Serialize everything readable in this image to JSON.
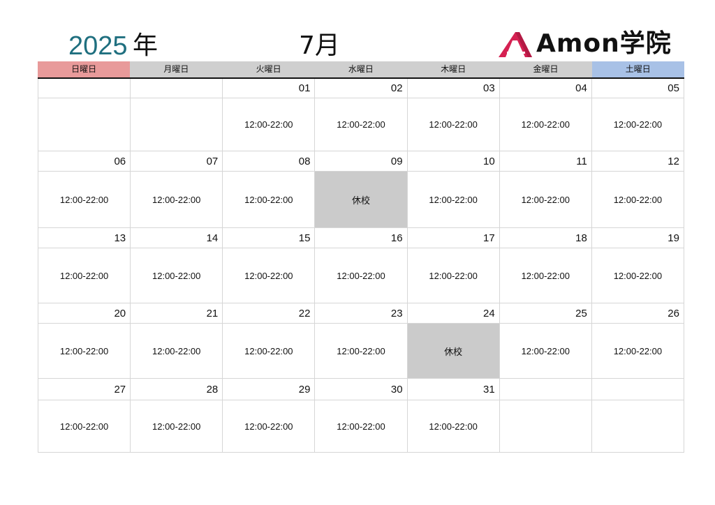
{
  "header": {
    "year": "2025",
    "year_suffix": "年",
    "month": "7月",
    "logo_text": "Amon学院",
    "logo_color": "#d52152"
  },
  "weekdays": [
    "日曜日",
    "月曜日",
    "火曜日",
    "水曜日",
    "木曜日",
    "金曜日",
    "土曜日"
  ],
  "colors": {
    "sunday": "#e89a9a",
    "saturday": "#a8c1e6",
    "weekday": "#cfcfcf",
    "closed": "#cbcbcb",
    "year": "#1f6f7f"
  },
  "weeks": [
    {
      "days": [
        {
          "date": "",
          "event": ""
        },
        {
          "date": "",
          "event": ""
        },
        {
          "date": "01",
          "event": "12:00-22:00"
        },
        {
          "date": "02",
          "event": "12:00-22:00"
        },
        {
          "date": "03",
          "event": "12:00-22:00"
        },
        {
          "date": "04",
          "event": "12:00-22:00"
        },
        {
          "date": "05",
          "event": "12:00-22:00"
        }
      ]
    },
    {
      "days": [
        {
          "date": "06",
          "event": "12:00-22:00"
        },
        {
          "date": "07",
          "event": "12:00-22:00"
        },
        {
          "date": "08",
          "event": "12:00-22:00"
        },
        {
          "date": "09",
          "event": "休校",
          "closed": true
        },
        {
          "date": "10",
          "event": "12:00-22:00"
        },
        {
          "date": "11",
          "event": "12:00-22:00"
        },
        {
          "date": "12",
          "event": "12:00-22:00"
        }
      ]
    },
    {
      "days": [
        {
          "date": "13",
          "event": "12:00-22:00"
        },
        {
          "date": "14",
          "event": "12:00-22:00"
        },
        {
          "date": "15",
          "event": "12:00-22:00"
        },
        {
          "date": "16",
          "event": "12:00-22:00"
        },
        {
          "date": "17",
          "event": "12:00-22:00"
        },
        {
          "date": "18",
          "event": "12:00-22:00"
        },
        {
          "date": "19",
          "event": "12:00-22:00"
        }
      ]
    },
    {
      "days": [
        {
          "date": "20",
          "event": "12:00-22:00"
        },
        {
          "date": "21",
          "event": "12:00-22:00"
        },
        {
          "date": "22",
          "event": "12:00-22:00"
        },
        {
          "date": "23",
          "event": "12:00-22:00"
        },
        {
          "date": "24",
          "event": "休校",
          "closed": true
        },
        {
          "date": "25",
          "event": "12:00-22:00"
        },
        {
          "date": "26",
          "event": "12:00-22:00"
        }
      ]
    },
    {
      "days": [
        {
          "date": "27",
          "event": "12:00-22:00"
        },
        {
          "date": "28",
          "event": "12:00-22:00"
        },
        {
          "date": "29",
          "event": "12:00-22:00"
        },
        {
          "date": "30",
          "event": "12:00-22:00"
        },
        {
          "date": "31",
          "event": "12:00-22:00"
        },
        {
          "date": "",
          "event": ""
        },
        {
          "date": "",
          "event": ""
        }
      ]
    }
  ]
}
